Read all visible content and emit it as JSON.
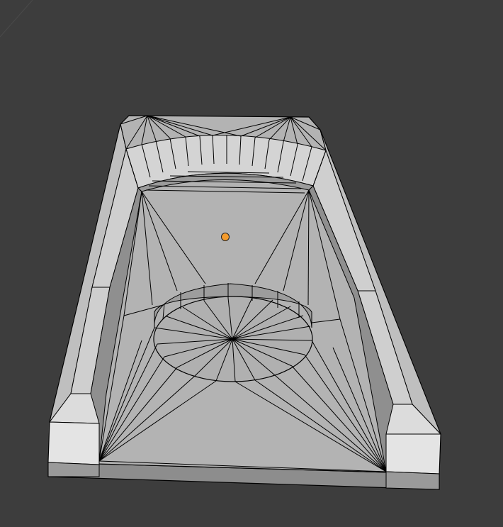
{
  "viewport": {
    "background": "#3d3d3d",
    "mesh_face_color": "#b3b3b3",
    "mesh_light_face_color": "#c8c8c8",
    "mesh_dark_face_color": "#8f8f8f",
    "mesh_wire_color": "#000000",
    "origin_color": "#f39b2d",
    "origin_icon": "object-origin-dot"
  }
}
